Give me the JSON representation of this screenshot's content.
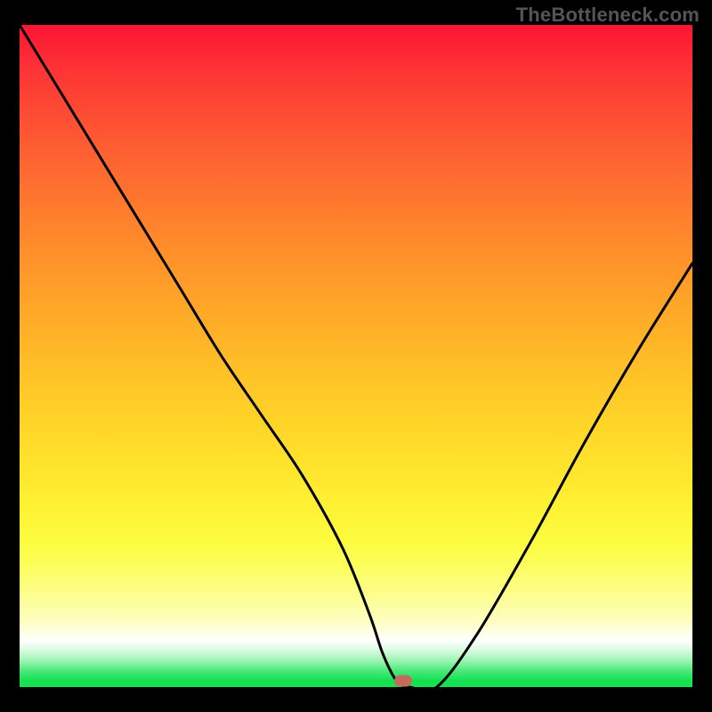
{
  "watermark": "TheBottleneck.com",
  "chart_data": {
    "type": "line",
    "title": "",
    "xlabel": "",
    "ylabel": "",
    "xlim": [
      0,
      100
    ],
    "ylim": [
      0,
      100
    ],
    "grid": false,
    "series": [
      {
        "name": "bottleneck-curve",
        "x": [
          0,
          6,
          12,
          18,
          24,
          30,
          36,
          42,
          48,
          52,
          54,
          56,
          58,
          62,
          68,
          76,
          84,
          92,
          100
        ],
        "values": [
          100,
          90,
          80,
          70,
          60,
          50,
          41,
          32,
          21,
          11,
          5,
          1,
          0,
          0,
          8,
          22,
          37,
          51,
          64
        ]
      }
    ],
    "marker": {
      "x": 57,
      "y": 0.9,
      "color": "#c76a5e"
    },
    "background_gradient": {
      "top": "#fc1434",
      "mid": "#ffd428",
      "bottom": "#14e251"
    }
  }
}
